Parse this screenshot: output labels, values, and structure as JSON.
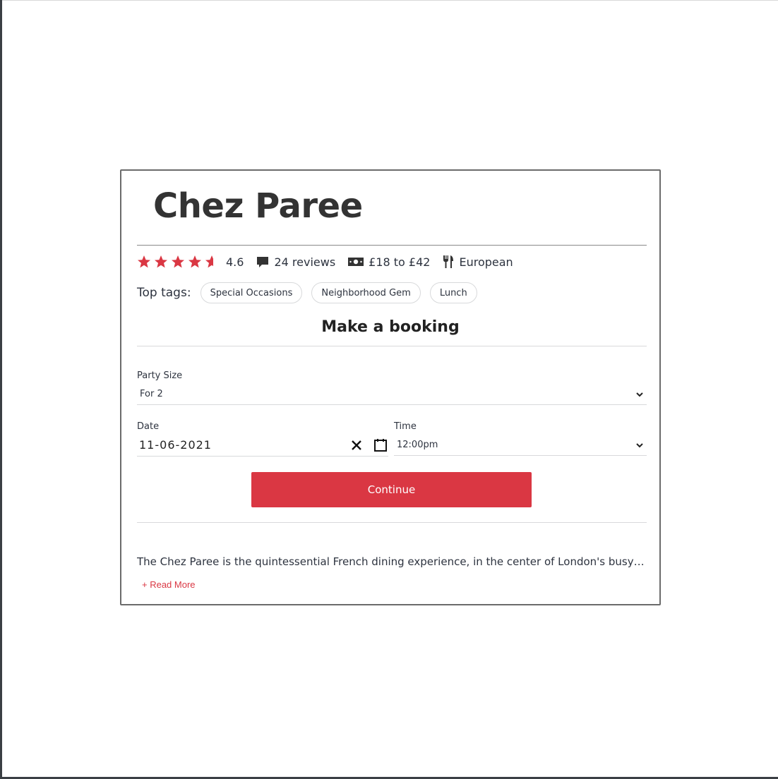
{
  "restaurant": {
    "name": "Chez Paree",
    "rating": {
      "value": 4.6,
      "label": "4.6",
      "stars_max": 5,
      "star_color": "#da3743"
    },
    "reviews_label": "24 reviews",
    "price_range": "£18 to £42",
    "cuisine": "European"
  },
  "tags": {
    "label": "Top tags:",
    "items": [
      "Special Occasions",
      "Neighborhood Gem",
      "Lunch"
    ]
  },
  "booking": {
    "title": "Make a booking",
    "party_size": {
      "label": "Party Size",
      "value": "For 2"
    },
    "date": {
      "label": "Date",
      "value": "11-06-2021"
    },
    "time": {
      "label": "Time",
      "value": "12:00pm"
    },
    "continue_label": "Continue",
    "accent_color": "#da3743"
  },
  "description": {
    "text": "The Chez Paree is the quintessential French dining experience, in the center of London's busy ...",
    "read_more_label": "+ Read More"
  },
  "icons": {
    "rating": "star-icon",
    "reviews": "speech-bubble-icon",
    "price": "banknote-icon",
    "cuisine": "fork-knife-icon",
    "clear_date": "close-icon",
    "calendar": "calendar-icon",
    "dropdown": "chevron-down-icon"
  }
}
